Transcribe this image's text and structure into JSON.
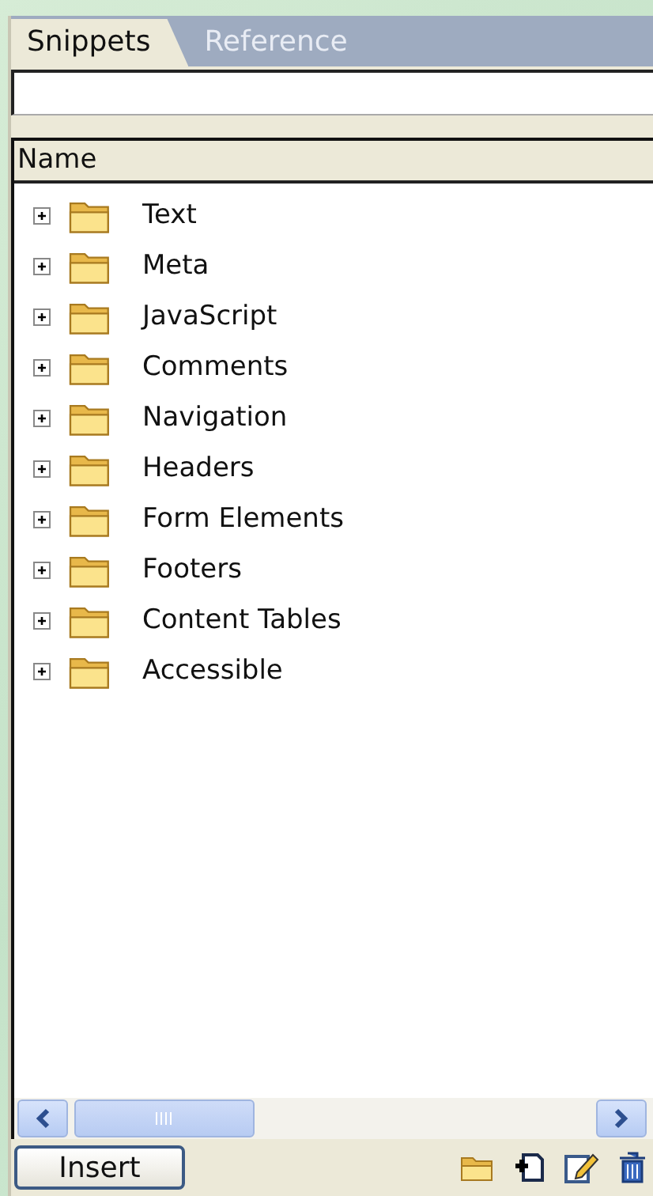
{
  "tabs": [
    {
      "label": "Snippets",
      "selected": true
    },
    {
      "label": "Reference",
      "selected": false
    }
  ],
  "list": {
    "columns": [
      "Name"
    ],
    "items": [
      {
        "label": "Text",
        "expanded": false
      },
      {
        "label": "Meta",
        "expanded": false
      },
      {
        "label": "JavaScript",
        "expanded": false
      },
      {
        "label": "Comments",
        "expanded": false
      },
      {
        "label": "Navigation",
        "expanded": false
      },
      {
        "label": "Headers",
        "expanded": false
      },
      {
        "label": "Form Elements",
        "expanded": false
      },
      {
        "label": "Footers",
        "expanded": false
      },
      {
        "label": "Content Tables",
        "expanded": false
      },
      {
        "label": "Accessible",
        "expanded": false
      }
    ]
  },
  "buttons": [
    "Insert"
  ]
}
